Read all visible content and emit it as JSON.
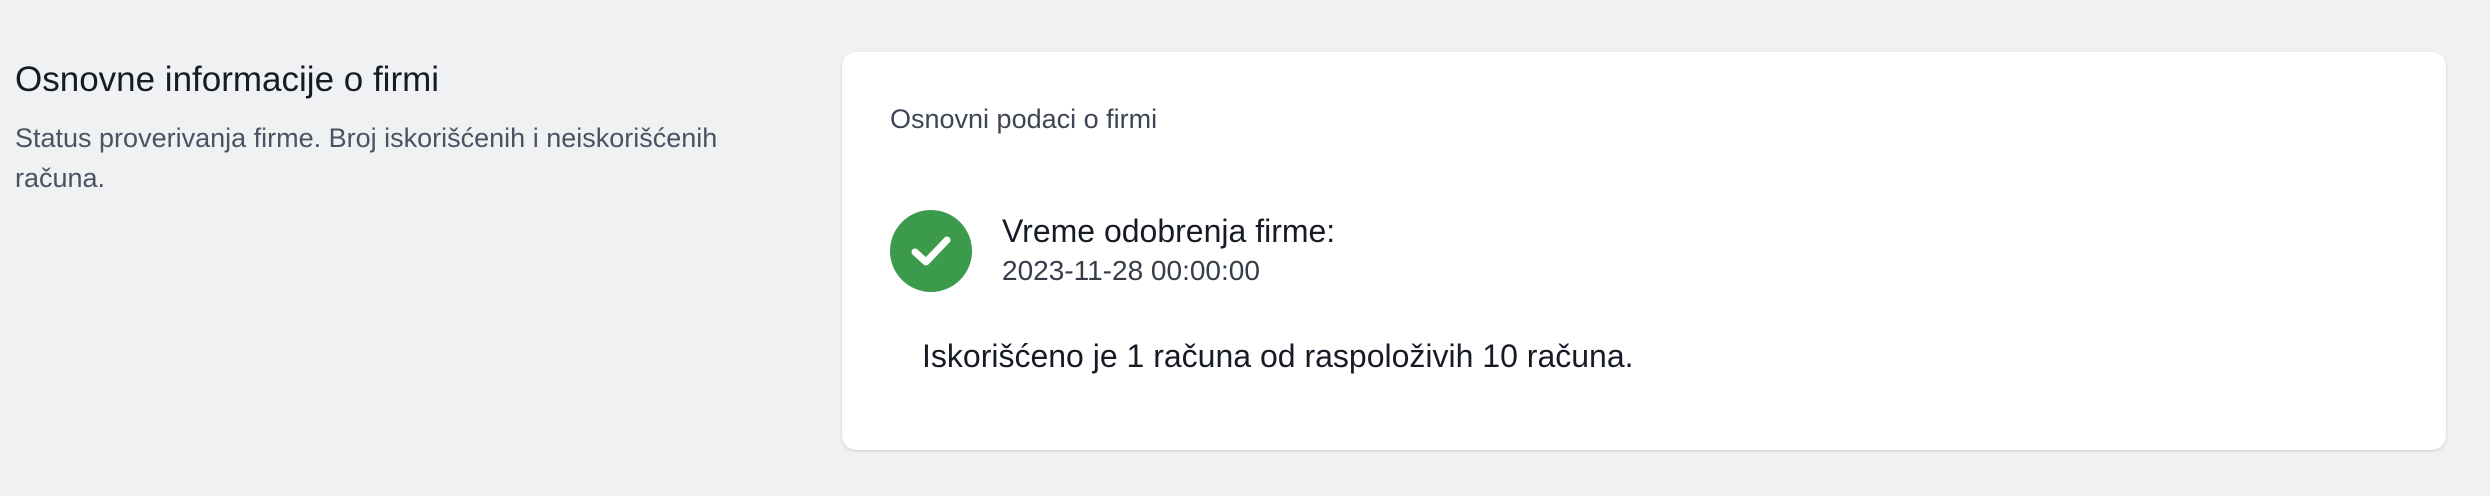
{
  "section": {
    "title": "Osnovne informacije o firmi",
    "description": "Status proverivanja firme. Broj iskorišćenih i neiskorišćenih računa."
  },
  "card": {
    "title": "Osnovni podaci o firmi",
    "status": {
      "icon": "check-circle-icon",
      "color": "#3b9a4c",
      "label": "Vreme odobrenja firme:",
      "value": "2023-11-28 00:00:00"
    },
    "usage_text": "Iskorišćeno je 1 računa od raspoloživih 10 računa."
  }
}
